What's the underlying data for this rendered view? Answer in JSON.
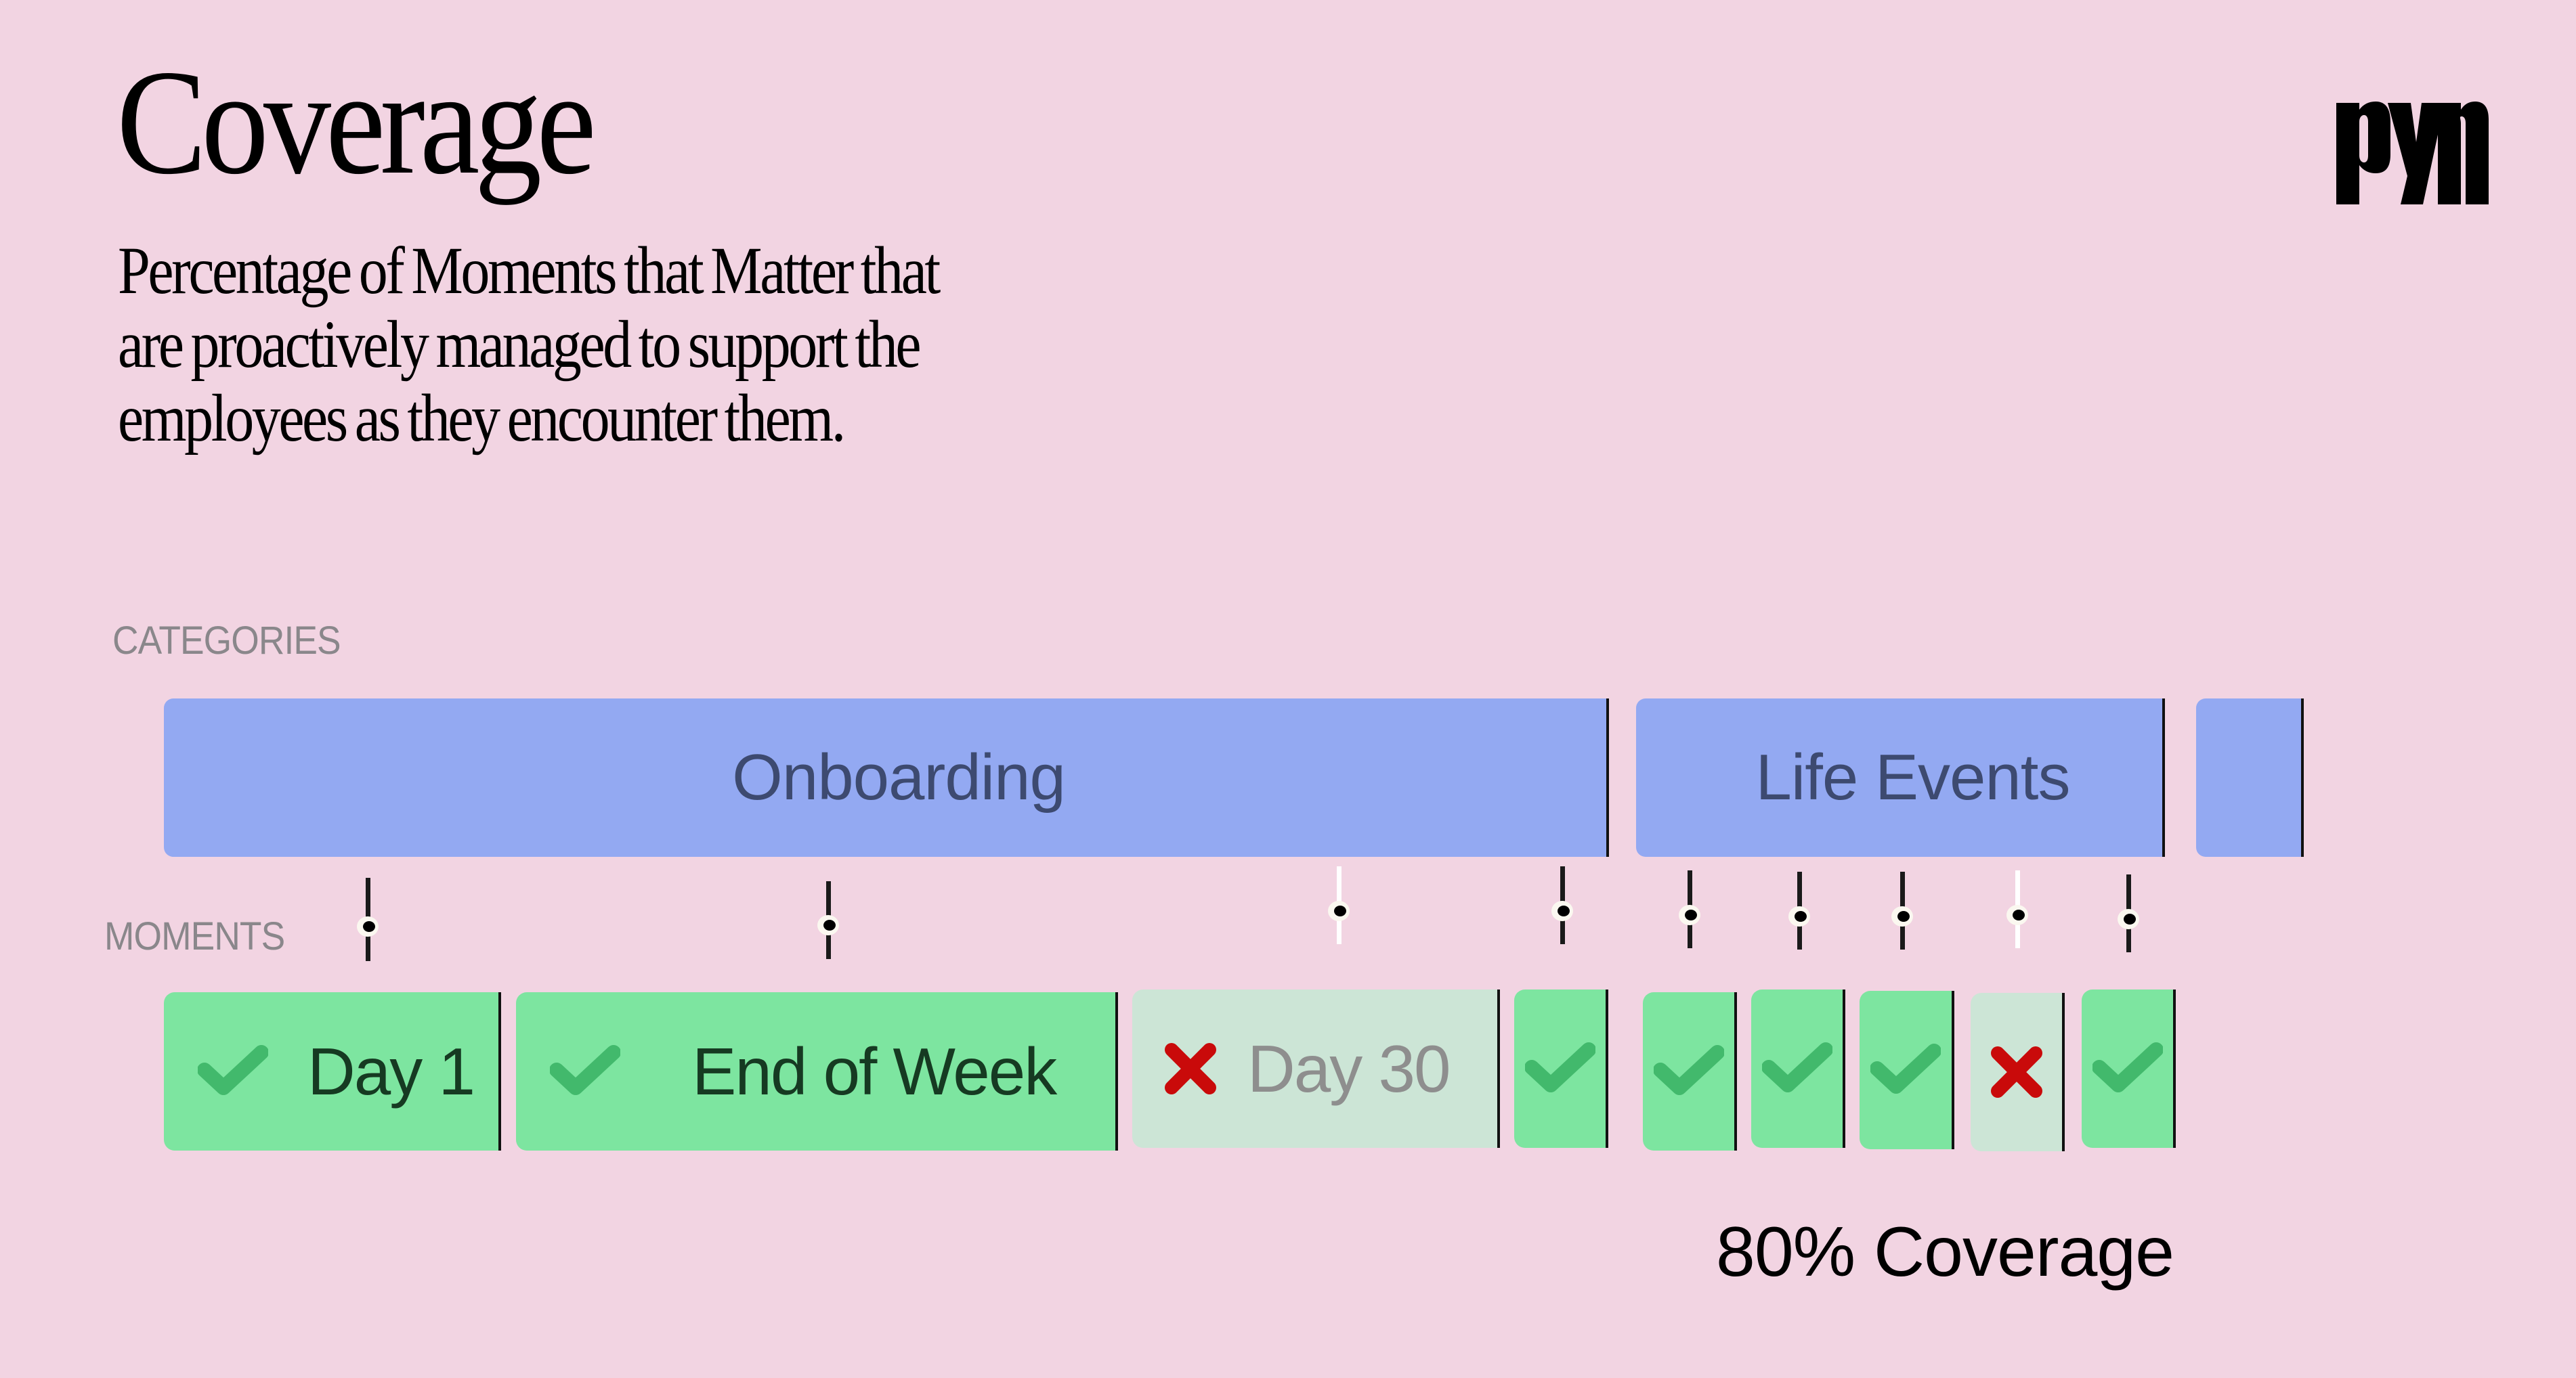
{
  "header": {
    "title": "Coverage",
    "subtitle_lines": [
      "Percentage of Moments that Matter that",
      "are proactively managed to support the",
      "employees as they encounter them."
    ],
    "logo_text": "pyn"
  },
  "labels": {
    "categories": "CATEGORIES",
    "moments": "MOMENTS"
  },
  "colors": {
    "background": "#f2d4e2",
    "category": "#93a9f2",
    "category_text": "#3d4a70",
    "managed": "#7de5a0",
    "managed_icon": "#42b96c",
    "unmanaged": "#cce5d6",
    "unmanaged_icon": "#c90a0a",
    "unmanaged_text": "#8e8e8e"
  },
  "categories": [
    {
      "label": "Onboarding"
    },
    {
      "label": "Life Events"
    },
    {
      "label": ""
    }
  ],
  "moments": [
    {
      "label": "Day 1",
      "category": "Onboarding",
      "status": "managed",
      "icon": "check-icon"
    },
    {
      "label": "End of Week",
      "category": "Onboarding",
      "status": "managed",
      "icon": "check-icon"
    },
    {
      "label": "Day 30",
      "category": "Onboarding",
      "status": "unmanaged",
      "icon": "x-icon"
    },
    {
      "label": "",
      "category": "Onboarding",
      "status": "managed",
      "icon": "check-icon"
    },
    {
      "label": "",
      "category": "Life Events",
      "status": "managed",
      "icon": "check-icon"
    },
    {
      "label": "",
      "category": "Life Events",
      "status": "managed",
      "icon": "check-icon"
    },
    {
      "label": "",
      "category": "Life Events",
      "status": "managed",
      "icon": "check-icon"
    },
    {
      "label": "",
      "category": "Life Events",
      "status": "unmanaged",
      "icon": "x-icon"
    },
    {
      "label": "",
      "category": "Life Events",
      "status": "managed",
      "icon": "check-icon"
    }
  ],
  "summary": {
    "coverage_percent": 80,
    "coverage_text": "80% Coverage"
  }
}
